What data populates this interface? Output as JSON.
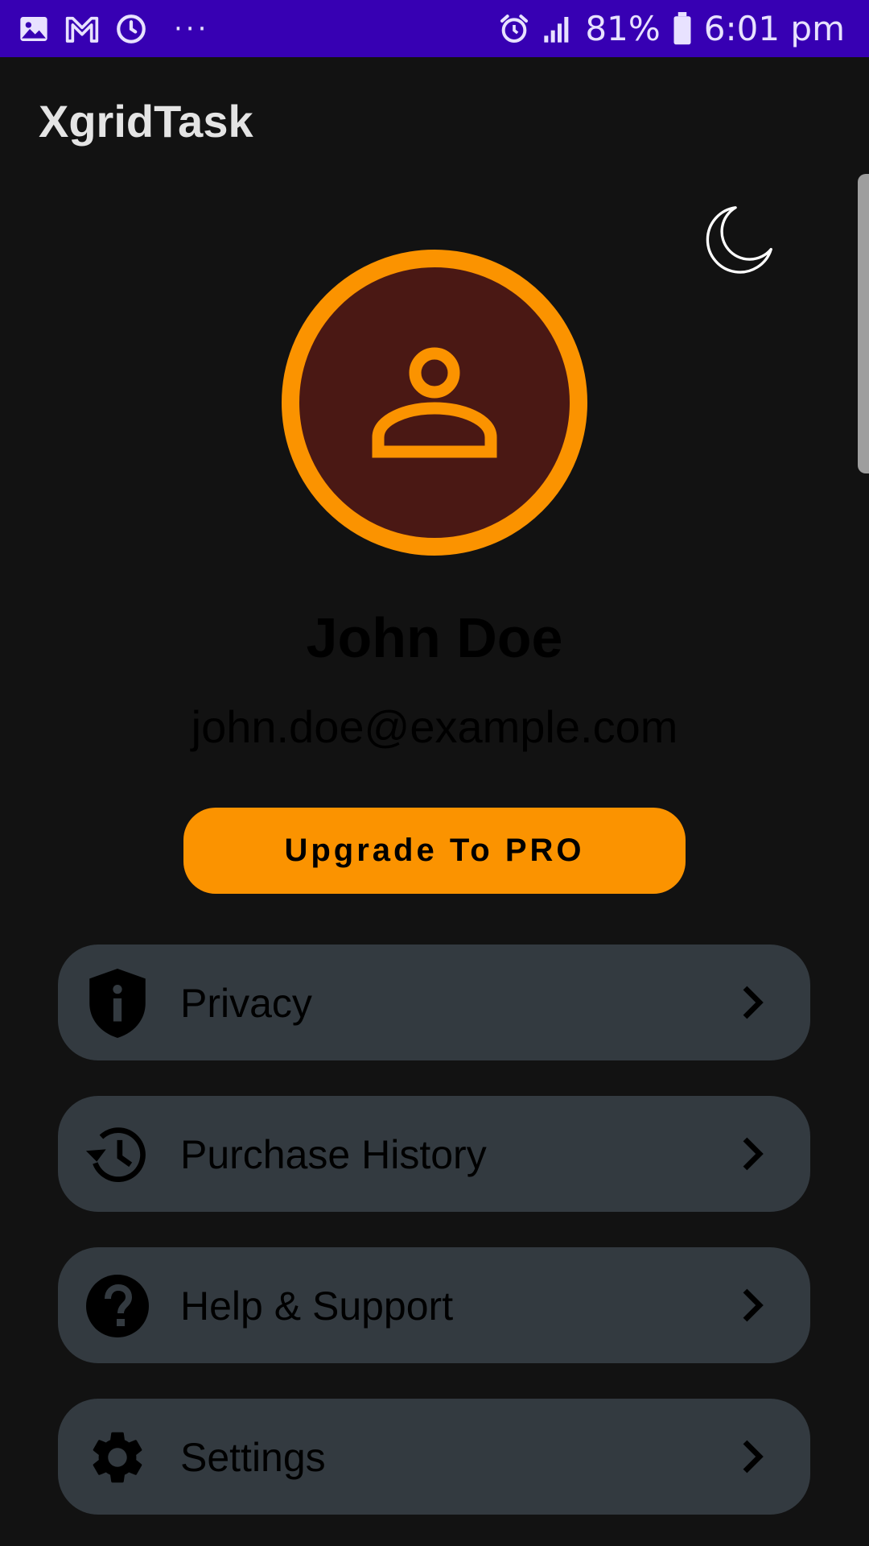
{
  "status_bar": {
    "battery": "81%",
    "time": "6:01 pm",
    "more": "···",
    "left_icons": [
      "gallery-icon",
      "gmail-icon",
      "sync-icon"
    ],
    "right_icons": [
      "alarm-icon",
      "signal-icon",
      "battery-icon"
    ]
  },
  "app": {
    "title": "XgridTask"
  },
  "profile": {
    "name": "John Doe",
    "email": "john.doe@example.com",
    "avatar_icon": "person-icon",
    "theme_icon": "moon-icon"
  },
  "upgrade": {
    "label": "Upgrade To PRO"
  },
  "menu": [
    {
      "label": "Privacy",
      "icon": "shield-info-icon"
    },
    {
      "label": "Purchase History",
      "icon": "history-icon"
    },
    {
      "label": "Help & Support",
      "icon": "help-icon"
    },
    {
      "label": "Settings",
      "icon": "gear-icon"
    }
  ],
  "colors": {
    "status_bar": "#3700b3",
    "background": "#121212",
    "accent": "#fb9300",
    "avatar_fill": "#4a1814",
    "menu_item": "#333a40"
  }
}
